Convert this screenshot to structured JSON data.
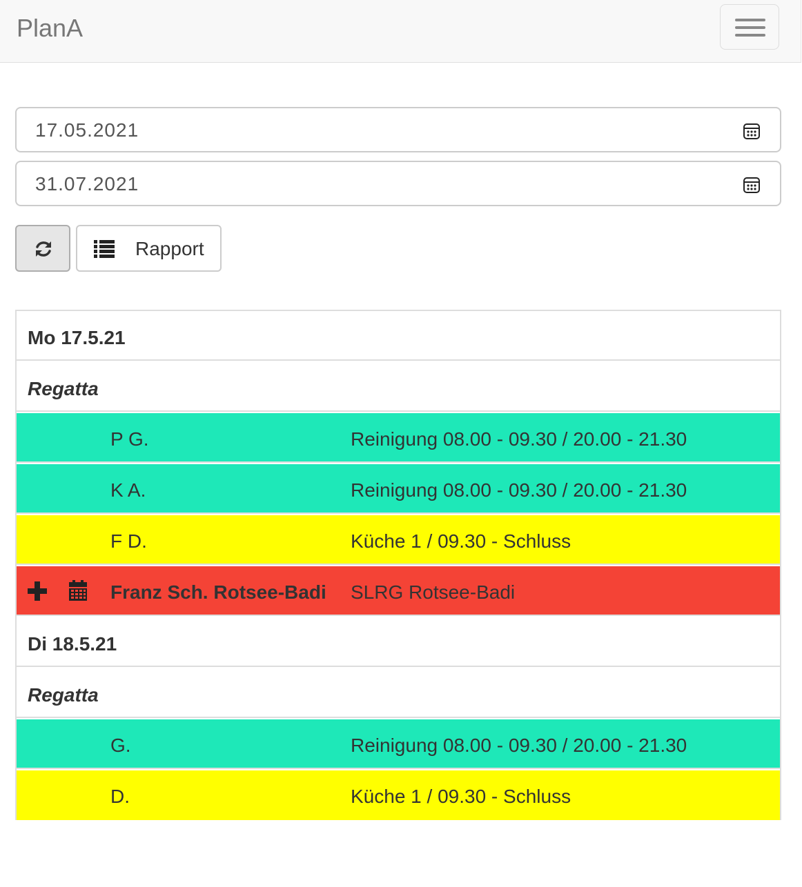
{
  "navbar": {
    "brand": "PlanA"
  },
  "filters": {
    "from_date": "17.05.2021",
    "to_date": "31.07.2021"
  },
  "toolbar": {
    "report_label": "Rapport"
  },
  "colors": {
    "green": "#1ee8b8",
    "yellow": "#ffff00",
    "red": "#f44336"
  },
  "days": [
    {
      "date": "Mo 17.5.21",
      "event": "Regatta",
      "entries": [
        {
          "name": "P G.",
          "task": "Reinigung 08.00 - 09.30 / 20.00 - 21.30",
          "color": "green"
        },
        {
          "name": "K A.",
          "task": "Reinigung 08.00 - 09.30 / 20.00 - 21.30",
          "color": "green"
        },
        {
          "name": "F D.",
          "task": "Küche 1 / 09.30 - Schluss",
          "color": "yellow"
        },
        {
          "name": "Franz Sch. Rotsee-Badi",
          "task": "SLRG Rotsee-Badi",
          "color": "red"
        }
      ]
    },
    {
      "date": "Di 18.5.21",
      "event": "Regatta",
      "entries": [
        {
          "name": "G.",
          "task": "Reinigung 08.00 - 09.30 / 20.00 - 21.30",
          "color": "green"
        },
        {
          "name": "D.",
          "task": "Küche 1 / 09.30 - Schluss",
          "color": "yellow"
        }
      ]
    }
  ]
}
